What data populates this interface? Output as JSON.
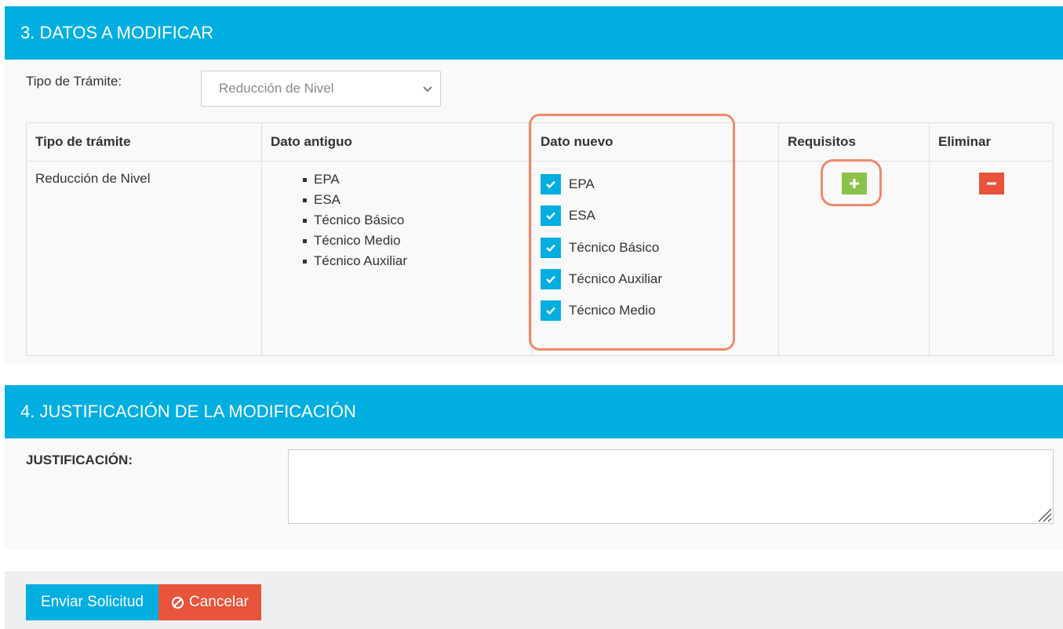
{
  "section3": {
    "title": "3. DATOS A MODIFICAR",
    "tipo_label": "Tipo de Trámite:",
    "tipo_select_value": "Reducción de Nivel",
    "table": {
      "headers": [
        "Tipo de trámite",
        "Dato antiguo",
        "Dato nuevo",
        "Requisitos",
        "Eliminar"
      ],
      "row": {
        "tipo": "Reducción de Nivel",
        "dato_antiguo": [
          "EPA",
          "ESA",
          "Técnico Básico",
          "Técnico Medio",
          "Técnico Auxiliar"
        ],
        "dato_nuevo": [
          {
            "label": "EPA",
            "checked": true
          },
          {
            "label": "ESA",
            "checked": true
          },
          {
            "label": "Técnico Básico",
            "checked": true
          },
          {
            "label": "Técnico Auxiliar",
            "checked": true
          },
          {
            "label": "Técnico Medio",
            "checked": true
          }
        ]
      }
    }
  },
  "section4": {
    "title": "4. JUSTIFICACIÓN DE LA MODIFICACIÓN",
    "justificacion_label": "JUSTIFICACIÓN:",
    "justificacion_value": ""
  },
  "footer": {
    "send_label": "Enviar Solicitud",
    "cancel_label": "Cancelar"
  },
  "colors": {
    "header_bg": "#00aee0",
    "add_button": "#8bc34a",
    "delete_button": "#e8533b",
    "highlight": "#f0896a"
  },
  "icons": {
    "add": "plus-icon",
    "delete": "minus-icon",
    "cancel": "ban-icon",
    "select": "chevron-down-icon",
    "check": "check-icon"
  }
}
